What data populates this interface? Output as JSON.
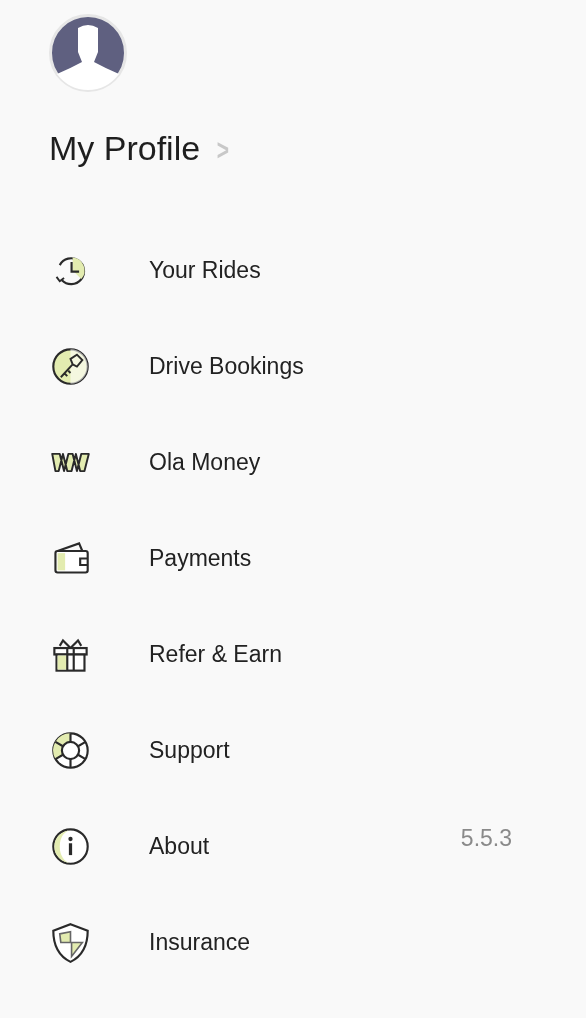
{
  "profile": {
    "title": "My Profile",
    "chevron": ">"
  },
  "menu": [
    {
      "kind": "clock",
      "label": "Your Rides"
    },
    {
      "kind": "key",
      "label": "Drive Bookings"
    },
    {
      "kind": "money",
      "label": "Ola Money"
    },
    {
      "kind": "wallet",
      "label": "Payments"
    },
    {
      "kind": "gift",
      "label": "Refer & Earn"
    },
    {
      "kind": "lifebuoy",
      "label": "Support"
    },
    {
      "kind": "info",
      "label": "About",
      "version": "5.5.3"
    },
    {
      "kind": "shield",
      "label": "Insurance"
    }
  ]
}
